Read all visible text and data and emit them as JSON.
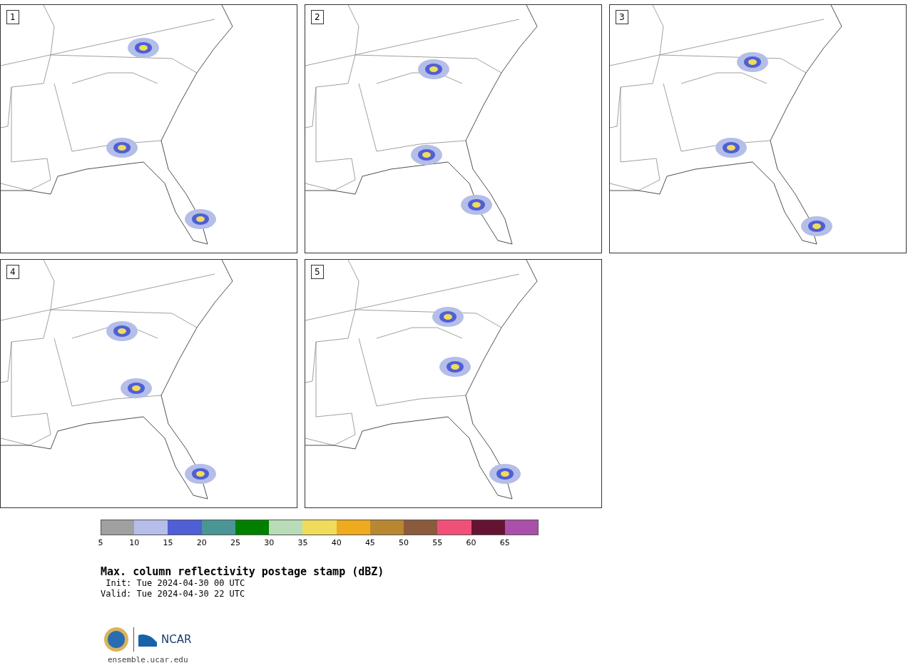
{
  "panels": [
    {
      "label": "1"
    },
    {
      "label": "2"
    },
    {
      "label": "3"
    },
    {
      "label": "4"
    },
    {
      "label": "5"
    }
  ],
  "colorbar": {
    "segments": [
      {
        "color": "#a0a0a0",
        "tick": "5"
      },
      {
        "color": "#b4bee8",
        "tick": "10"
      },
      {
        "color": "#4f5fd6",
        "tick": "15"
      },
      {
        "color": "#4a9696",
        "tick": "20"
      },
      {
        "color": "#008000",
        "tick": "25"
      },
      {
        "color": "#b8dcb8",
        "tick": "30"
      },
      {
        "color": "#f0dc5a",
        "tick": "35"
      },
      {
        "color": "#f0aa1e",
        "tick": "40"
      },
      {
        "color": "#b98632",
        "tick": "45"
      },
      {
        "color": "#8c5a3c",
        "tick": "50"
      },
      {
        "color": "#f05078",
        "tick": "55"
      },
      {
        "color": "#641432",
        "tick": "60"
      },
      {
        "color": "#aa50aa",
        "tick": "65"
      }
    ]
  },
  "title": "Max. column reflectivity postage stamp (dBZ)",
  "init": " Init: Tue 2024-04-30 00 UTC",
  "valid": "Valid: Tue 2024-04-30 22 UTC",
  "logo": {
    "text": "NCAR"
  },
  "url": "ensemble.ucar.edu"
}
